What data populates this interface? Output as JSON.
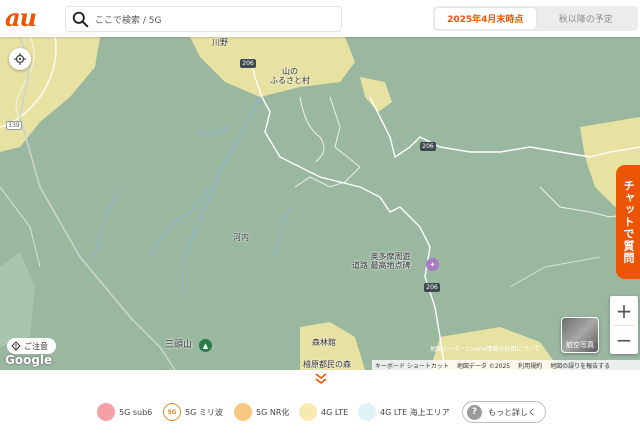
{
  "header": {
    "logo": "au",
    "search_placeholder": "ここで検索 / 5G",
    "tabs": [
      {
        "label": "2025年4月末時点",
        "active": true
      },
      {
        "label": "秋以降の予定",
        "active": false
      }
    ]
  },
  "map": {
    "places": {
      "kawano": "川野",
      "yama_furusato": "山の\nふるさと村",
      "kawachi": "河内",
      "okutama_monument": "奥多摩周遊\n道路 最高地点碑",
      "mitoyama": "三頭山",
      "shinrinkan": "森林館",
      "hinohara_partial": "檜原都民の森"
    },
    "roads": {
      "r139": "139",
      "r206a": "206",
      "r206b": "206",
      "r206c": "206"
    },
    "chat_button": "チャットで質問",
    "zoom_in": "+",
    "zoom_out": "−",
    "aerial_label": "航空写真",
    "notice_label": "ご注意",
    "google_logo": "Google",
    "map_data_overlay": "地図データ・Cookie情報の利用について",
    "attribution": [
      "キーボード ショートカット",
      "地図データ ©2025",
      "利用規約",
      "地図の誤りを報告する"
    ]
  },
  "legend": {
    "items": [
      {
        "label": "5G sub6",
        "color": "#f4a0a6"
      },
      {
        "label": "5G ミリ波",
        "color": "#ffffff",
        "badge": "5G"
      },
      {
        "label": "5G NR化",
        "color": "#f7c980"
      },
      {
        "label": "4G LTE",
        "color": "#f7eab0"
      },
      {
        "label": "4G LTE 海上エリア",
        "color": "#dff2f6"
      }
    ],
    "more_label": "もっと詳しく",
    "more_icon": "?"
  },
  "colors": {
    "brand": "#eb5505",
    "map_coverage": "#9ab7a0",
    "map_lte": "#e7e1a2"
  }
}
